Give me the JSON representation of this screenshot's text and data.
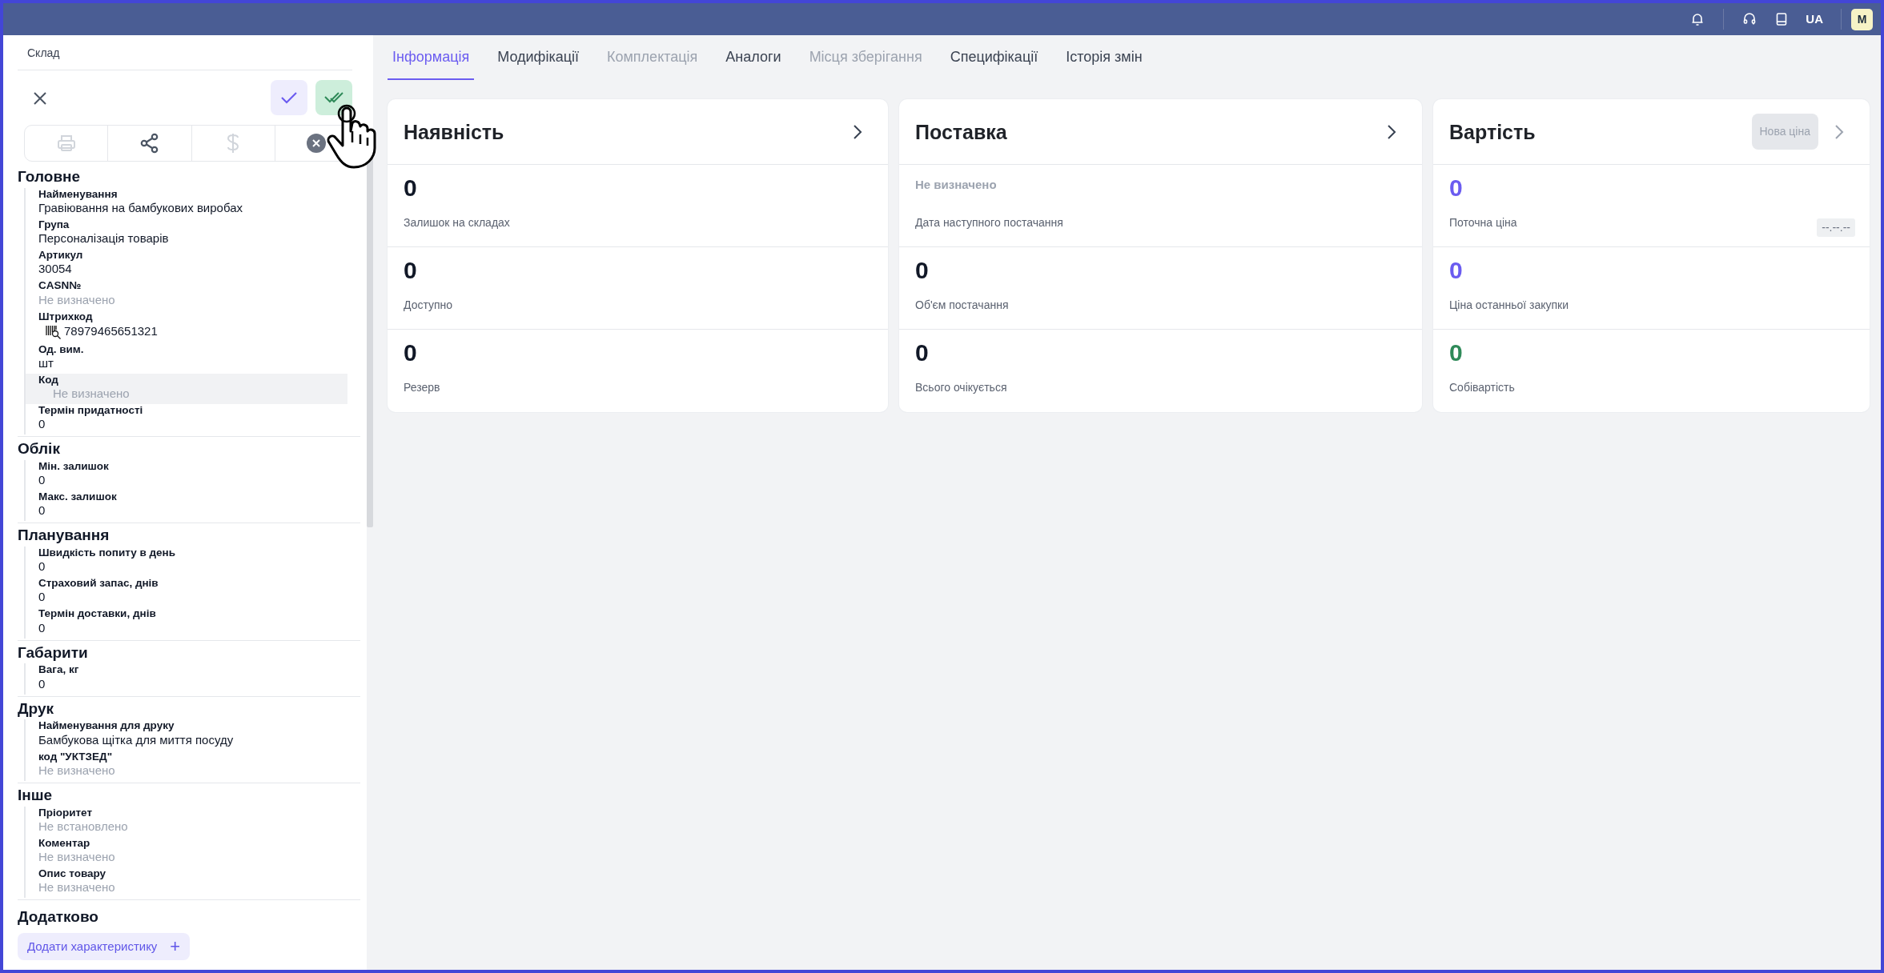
{
  "topbar": {
    "language": "UA",
    "avatar": "M",
    "icons": [
      {
        "kind": "bell"
      },
      {
        "kind": "headset"
      },
      {
        "kind": "book"
      }
    ]
  },
  "panel": {
    "title": "Склад",
    "toolbar": [
      {
        "kind": "print",
        "disabled": true
      },
      {
        "kind": "share",
        "disabled": false
      },
      {
        "kind": "dollar",
        "disabled": true
      },
      {
        "kind": "clear",
        "disabled": false
      }
    ],
    "sections": [
      {
        "title": "Головне",
        "fields": [
          {
            "label": "Найменування",
            "value": "Гравіювання на бамбукових виробах",
            "muted": false,
            "highlighted": false,
            "kind": "text"
          },
          {
            "label": "Група",
            "value": "Персоналізація товарів",
            "muted": false,
            "highlighted": false,
            "kind": "text"
          },
          {
            "label": "Артикул",
            "value": "30054",
            "muted": false,
            "highlighted": false,
            "kind": "text"
          },
          {
            "label": "CASN№",
            "value": "Не визначено",
            "muted": true,
            "highlighted": false,
            "kind": "text"
          },
          {
            "label": "Штрихкод",
            "value": "78979465651321",
            "muted": false,
            "highlighted": false,
            "kind": "barcode"
          },
          {
            "label": "Од. вим.",
            "value": "шт",
            "muted": false,
            "highlighted": false,
            "kind": "text"
          },
          {
            "label": "Код",
            "value": "Не визначено",
            "muted": true,
            "highlighted": true,
            "kind": "text"
          },
          {
            "label": "Термін придатності",
            "value": "0",
            "muted": false,
            "highlighted": false,
            "kind": "text"
          }
        ]
      },
      {
        "title": "Облік",
        "fields": [
          {
            "label": "Мін. залишок",
            "value": "0",
            "muted": false,
            "highlighted": false,
            "kind": "text"
          },
          {
            "label": "Макс. залишок",
            "value": "0",
            "muted": false,
            "highlighted": false,
            "kind": "text"
          }
        ]
      },
      {
        "title": "Планування",
        "fields": [
          {
            "label": "Швидкість попиту в день",
            "value": "0",
            "muted": false,
            "highlighted": false,
            "kind": "text"
          },
          {
            "label": "Страховий запас, днів",
            "value": "0",
            "muted": false,
            "highlighted": false,
            "kind": "text"
          },
          {
            "label": "Термін доставки, днів",
            "value": "0",
            "muted": false,
            "highlighted": false,
            "kind": "text"
          }
        ]
      },
      {
        "title": "Габарити",
        "fields": [
          {
            "label": "Вага, кг",
            "value": "0",
            "muted": false,
            "highlighted": false,
            "kind": "text"
          }
        ]
      },
      {
        "title": "Друк",
        "fields": [
          {
            "label": "Найменування для друку",
            "value": "Бамбукова щітка для миття посуду",
            "muted": false,
            "highlighted": false,
            "kind": "text"
          },
          {
            "label": "код \"УКТЗЕД\"",
            "value": "Не визначено",
            "muted": true,
            "highlighted": false,
            "kind": "text"
          }
        ]
      },
      {
        "title": "Інше",
        "fields": [
          {
            "label": "Пріоритет",
            "value": "Не встановлено",
            "muted": true,
            "highlighted": false,
            "kind": "text"
          },
          {
            "label": "Коментар",
            "value": "Не визначено",
            "muted": true,
            "highlighted": false,
            "kind": "text"
          },
          {
            "label": "Опис товару",
            "value": "Не визначено",
            "muted": true,
            "highlighted": false,
            "kind": "text"
          }
        ]
      }
    ],
    "extra": {
      "title": "Додатково",
      "button": "Додати характеристику",
      "button_icon": "+"
    }
  },
  "tabs": [
    {
      "label": "Інформація",
      "selected": true,
      "disabled": false
    },
    {
      "label": "Модифікації",
      "selected": false,
      "disabled": false
    },
    {
      "label": "Комплектація",
      "selected": false,
      "disabled": true
    },
    {
      "label": "Аналоги",
      "selected": false,
      "disabled": false
    },
    {
      "label": "Місця зберігання",
      "selected": false,
      "disabled": true
    },
    {
      "label": "Специфікації",
      "selected": false,
      "disabled": false
    },
    {
      "label": "Історія змін",
      "selected": false,
      "disabled": false
    }
  ],
  "cards": [
    {
      "title": "Наявність",
      "chevron_disabled": false,
      "stats": [
        {
          "value": "0",
          "label": "Залишок на складах",
          "kind": "number",
          "color": "#111827"
        },
        {
          "value": "0",
          "label": "Доступно",
          "kind": "number",
          "color": "#111827"
        },
        {
          "value": "0",
          "label": "Резерв",
          "kind": "number",
          "color": "#111827"
        }
      ]
    },
    {
      "title": "Поставка",
      "chevron_disabled": false,
      "stats": [
        {
          "value": "Не визначено",
          "label": "Дата наступного постачання",
          "kind": "note",
          "color": "#9ca3af"
        },
        {
          "value": "0",
          "label": "Об'єм постачання",
          "kind": "number",
          "color": "#111827"
        },
        {
          "value": "0",
          "label": "Всього очікується",
          "kind": "number",
          "color": "#111827"
        }
      ]
    },
    {
      "title": "Вартість",
      "chevron_disabled": true,
      "action": {
        "label": "Нова ціна",
        "disabled": true
      },
      "stats": [
        {
          "value": "0",
          "label": "Поточна ціна",
          "kind": "number",
          "color": "#6b5cf0",
          "badge": "--.--.--"
        },
        {
          "value": "0",
          "label": "Ціна останньої закупки",
          "kind": "number",
          "color": "#6b5cf0"
        },
        {
          "value": "0",
          "label": "Собівартість",
          "kind": "number",
          "color": "#2f8a59"
        }
      ]
    }
  ]
}
